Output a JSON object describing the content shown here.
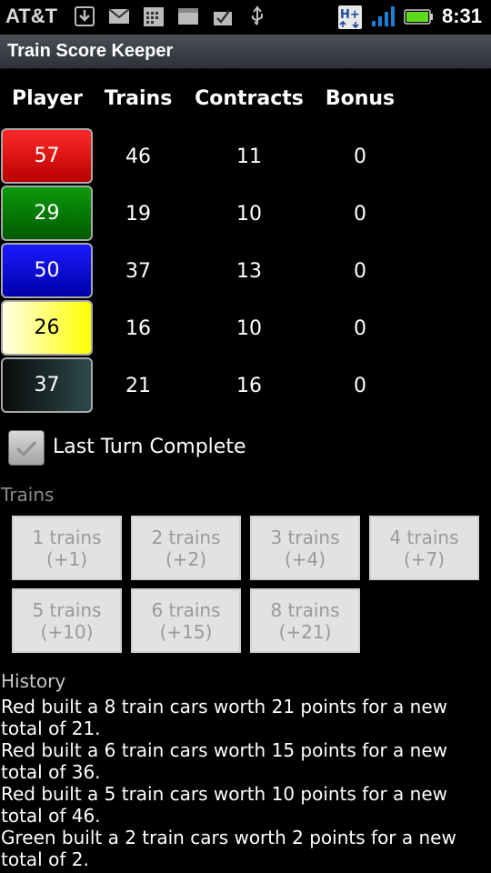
{
  "status_bar": {
    "carrier": "AT&T",
    "time": "8:31",
    "icons": [
      "download-icon",
      "mail-icon",
      "calendar-icon",
      "message-icon",
      "task-icon",
      "usb-icon",
      "hspa-icon",
      "signal-icon",
      "battery-icon"
    ],
    "network": "H+"
  },
  "app": {
    "title": "Train Score Keeper"
  },
  "table": {
    "headers": {
      "player": "Player",
      "trains": "Trains",
      "contracts": "Contracts",
      "bonus": "Bonus"
    },
    "rows": [
      {
        "color": "#e00000",
        "score": "57",
        "trains": "46",
        "contracts": "11",
        "bonus": "0"
      },
      {
        "color": "#007a00",
        "score": "29",
        "trains": "19",
        "contracts": "10",
        "bonus": "0"
      },
      {
        "color": "#0000d8",
        "score": "50",
        "trains": "37",
        "contracts": "13",
        "bonus": "0"
      },
      {
        "color": "#ffff00",
        "score": "26",
        "trains": "16",
        "contracts": "10",
        "bonus": "0"
      },
      {
        "color": "#1a2a2a",
        "score": "37",
        "trains": "21",
        "contracts": "16",
        "bonus": "0"
      }
    ]
  },
  "last_turn": {
    "label": "Last Turn Complete",
    "checked": true
  },
  "trains_section": {
    "label": "Trains",
    "buttons": [
      {
        "line1": "1 trains",
        "line2": "(+1)"
      },
      {
        "line1": "2 trains",
        "line2": "(+2)"
      },
      {
        "line1": "3 trains",
        "line2": "(+4)"
      },
      {
        "line1": "4 trains",
        "line2": "(+7)"
      },
      {
        "line1": "5 trains",
        "line2": "(+10)"
      },
      {
        "line1": "6 trains",
        "line2": "(+15)"
      },
      {
        "line1": "8 trains",
        "line2": "(+21)"
      }
    ]
  },
  "history": {
    "label": "History",
    "entries": [
      "Red built a 8 train cars worth 21 points for a new total of 21.",
      "Red built a 6 train cars worth 15 points for a new total of 36.",
      "Red built a 5 train cars worth 10 points for a new total of 46.",
      "Green built a 2 train cars worth 2 points for a new total of 2."
    ]
  }
}
